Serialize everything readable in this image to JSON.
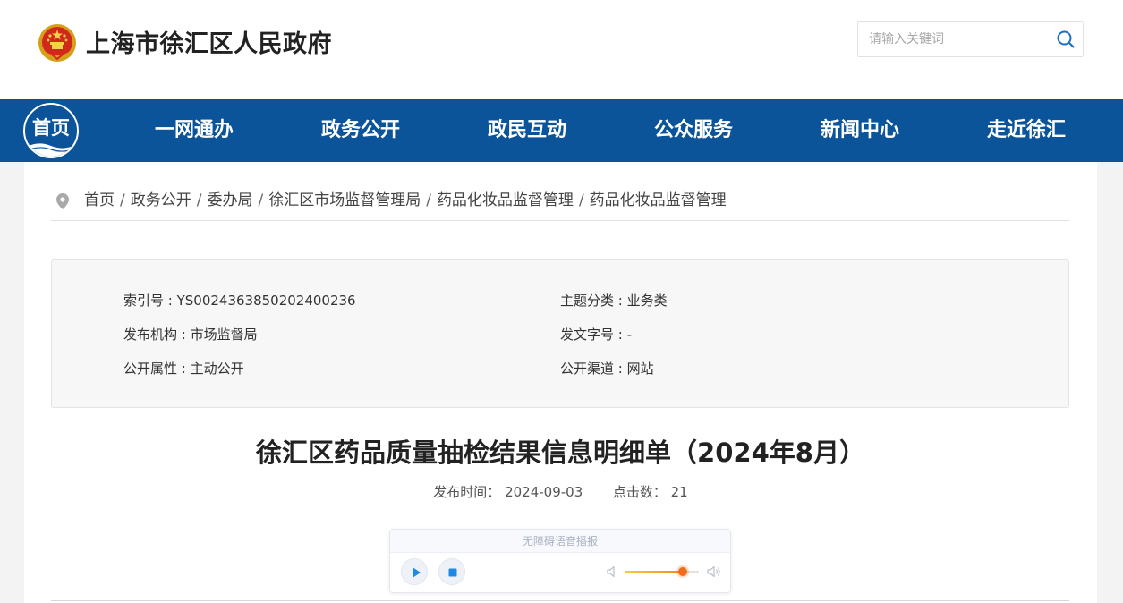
{
  "header": {
    "site_title": "上海市徐汇区人民政府",
    "search": {
      "placeholder": "请输入关键词",
      "value": ""
    },
    "emblem_icon": "national-emblem-icon",
    "search_icon": "search-icon"
  },
  "nav": {
    "home_label": "首页",
    "items": [
      {
        "label": "一网通办"
      },
      {
        "label": "政务公开"
      },
      {
        "label": "政民互动"
      },
      {
        "label": "公众服务"
      },
      {
        "label": "新闻中心"
      },
      {
        "label": "走近徐汇"
      }
    ]
  },
  "breadcrumb": {
    "icon": "location-pin-icon",
    "separator": "/",
    "items": [
      "首页",
      "政务公开",
      "委办局",
      "徐汇区市场监督管理局",
      "药品化妆品监督管理",
      "药品化妆品监督管理"
    ]
  },
  "meta": {
    "index_no": "索引号 : YS0024363850202400236",
    "topic": "主题分类 : 业务类",
    "publisher": "发布机构 : 市场监督局",
    "doc_no": "发文字号 : -",
    "disclosure": "公开属性 : 主动公开",
    "channel": "公开渠道 : 网站"
  },
  "article": {
    "title": "徐汇区药品质量抽检结果信息明细单（2024年8月）",
    "publish_label": "发布时间：",
    "publish_date": "2024-09-03",
    "clicks_label": "点击数：",
    "clicks": "21"
  },
  "player": {
    "title": "无障碍语音播报",
    "play_icon": "play-icon",
    "stop_icon": "stop-icon",
    "volume_low_icon": "volume-low-icon",
    "volume_high_icon": "volume-high-icon",
    "volume_level": 0.78
  },
  "colors": {
    "nav_bg": "#0b5499",
    "accent_orange": "#f06c1b",
    "play_blue": "#1e88e5"
  }
}
